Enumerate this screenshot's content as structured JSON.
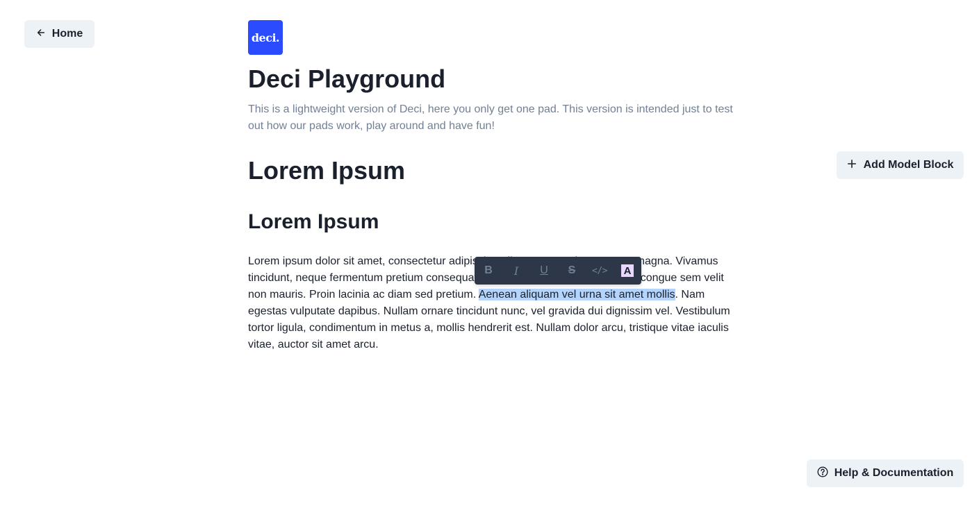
{
  "nav": {
    "home_label": "Home",
    "home_icon": "arrow-left-icon"
  },
  "header": {
    "logo_text": "deci.",
    "logo_color": "#2b4bff",
    "title": "Deci Playground",
    "description": "This is a lightweight version of Deci, here you only get one pad. This version is intended just to test out how our pads work, play around and have fun!"
  },
  "pad": {
    "heading1": "Lorem Ipsum",
    "heading2": "Lorem Ipsum",
    "paragraph": {
      "before_selection": "Lorem ipsum dolor sit amet, consectetur adipiscing elit. Praesent vitae ex eget magna. Vivamus tincidunt, neque fermentum pretium consequat, turpis leo scelerisque neque, at congue sem velit non mauris. Proin lacinia ac diam sed pretium. ",
      "selection": "Aenean aliquam vel urna sit amet mollis",
      "after_selection": ". Nam egestas vulputate dapibus. Nullam ornare tincidunt nunc, vel gravida dui dignissim vel. Vestibulum tortor ligula, condimentum in metus a, mollis hendrerit est. Nullam dolor arcu, tristique vitae iaculis vitae, auctor sit amet arcu."
    },
    "selection_color": "#b3d4fc"
  },
  "actions": {
    "add_model_block_label": "Add Model Block",
    "add_model_block_icon": "plus-icon",
    "help_label": "Help & Documentation",
    "help_icon": "question-circle-icon"
  },
  "format_toolbar": {
    "bold": "B",
    "italic": "I",
    "underline": "U",
    "strikethrough": "S",
    "code": "</>",
    "highlight": "A",
    "background_color": "#2d3748",
    "highlight_color": "#e9d8fd"
  }
}
